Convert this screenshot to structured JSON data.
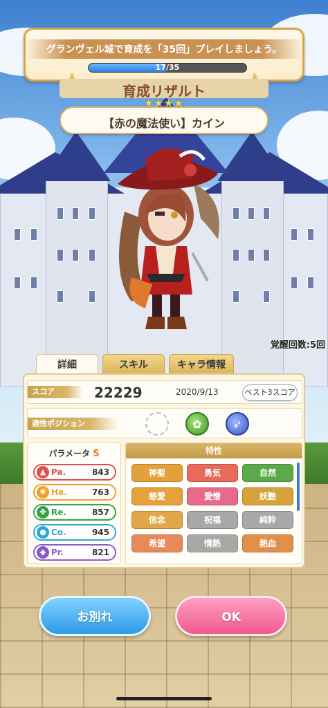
{
  "quest": {
    "text": "グランヴェル城で育成を「35回」プレイしましょう。",
    "progress_label": "17/35",
    "progress_value": 17,
    "progress_max": 35
  },
  "title_text": "育成リザルト",
  "rarity": "★★★★",
  "card_name": "【赤の魔法使い】カイン",
  "awaken_label": "覚醒回数:5回",
  "tabs": [
    "詳細",
    "スキル",
    "キャラ情報"
  ],
  "score": {
    "label": "スコア",
    "value": "22229",
    "date": "2020/9/13",
    "best_button": "ベスト3スコア"
  },
  "position": {
    "label": "適性ポジション"
  },
  "parameters": {
    "header": "パラメータ",
    "grade": "S",
    "rows": [
      {
        "name": "Pa.",
        "value": "843",
        "color": "#e0504a",
        "icon": "fire-icon"
      },
      {
        "name": "Ha.",
        "value": "763",
        "color": "#f0a02a",
        "icon": "sun-icon"
      },
      {
        "name": "Re.",
        "value": "857",
        "color": "#3aa04a",
        "icon": "clover-icon"
      },
      {
        "name": "Co.",
        "value": "945",
        "color": "#2fa8d8",
        "icon": "drop-icon"
      },
      {
        "name": "Pr.",
        "value": "821",
        "color": "#8a5ac8",
        "icon": "gem-icon"
      }
    ]
  },
  "traits": {
    "header": "特性",
    "items": [
      {
        "label": "神聖",
        "color": "#e4a13a"
      },
      {
        "label": "勇気",
        "color": "#e86a5a"
      },
      {
        "label": "自然",
        "color": "#5aaa4a"
      },
      {
        "label": "慈愛",
        "color": "#e6a23a"
      },
      {
        "label": "愛憎",
        "color": "#e86a8a"
      },
      {
        "label": "妖艶",
        "color": "#d8a23a"
      },
      {
        "label": "信念",
        "color": "#e0a84a"
      },
      {
        "label": "祝福",
        "color": "#a8a8a8"
      },
      {
        "label": "純粋",
        "color": "#a8a8a8"
      },
      {
        "label": "希望",
        "color": "#e68a5a"
      },
      {
        "label": "情熱",
        "color": "#a8a8a8"
      },
      {
        "label": "熱血",
        "color": "#e0904a"
      }
    ]
  },
  "buttons": {
    "leave": "お別れ",
    "ok": "OK"
  }
}
